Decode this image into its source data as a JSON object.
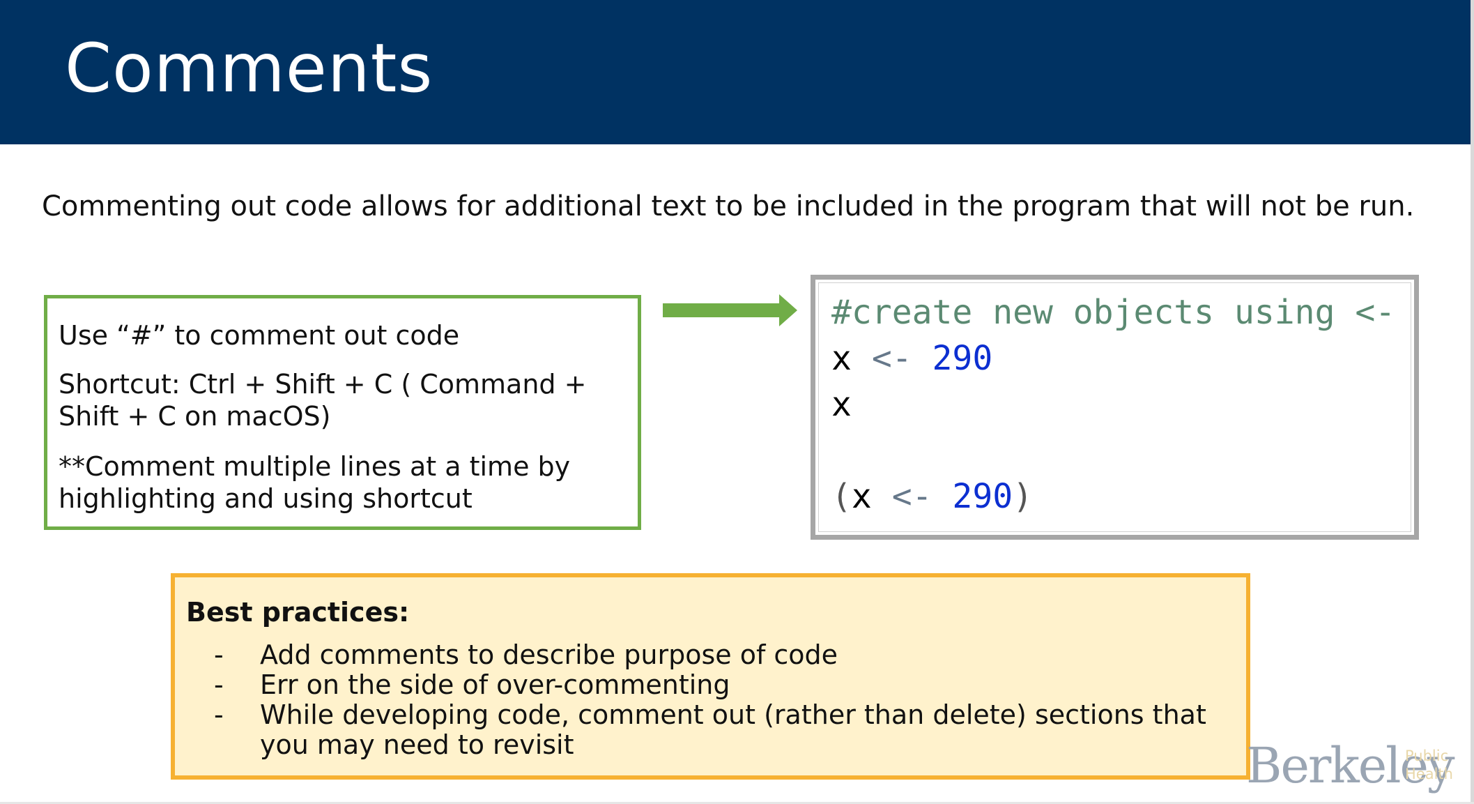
{
  "slide": {
    "title": "Comments",
    "intro": "Commenting out code allows for additional text to be included in the program that will not be run."
  },
  "instructions": {
    "line1": "Use “#” to comment out code",
    "line2": "Shortcut: Ctrl + Shift + C ( Command + Shift + C on macOS)",
    "line3": "**Comment multiple lines at a time by highlighting and using shortcut"
  },
  "code": {
    "comment": "#create new objects using <-",
    "var": "x",
    "assign_op": "<-",
    "value": "290",
    "open_paren": "(",
    "close_paren": ")"
  },
  "best_practices": {
    "title": "Best practices:",
    "bullet": "-",
    "items": [
      "Add comments to describe purpose of code",
      "Err on the side of over-commenting",
      "While developing code, comment out (rather than delete) sections that you may need to revisit"
    ]
  },
  "logo": {
    "word": "Berkeley",
    "sub_line1": "Public",
    "sub_line2": "Health"
  },
  "colors": {
    "header": "#003262",
    "green_border": "#70ad47",
    "orange_border": "#f6b132",
    "orange_fill": "#fff2cc",
    "code_border": "#a6a6a6",
    "code_comment": "#5b8a72",
    "code_number": "#0c2fd1"
  }
}
